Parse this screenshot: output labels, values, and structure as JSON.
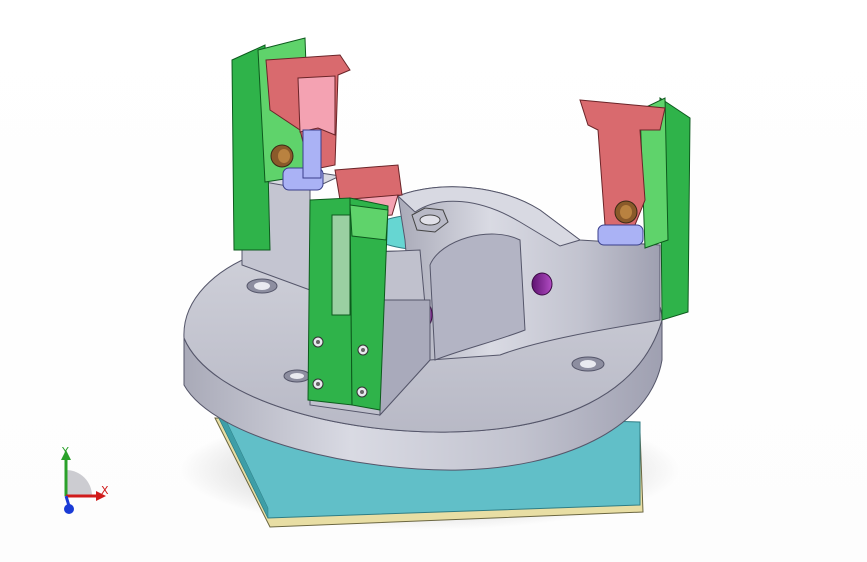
{
  "viewport": {
    "background": "#ffffff"
  },
  "colors": {
    "base_plate": "#61bfc8",
    "base_plate_shadow": "#3e9ea7",
    "shim": "#e8dea4",
    "fixture_body": "#c6c7d2",
    "fixture_body_shade": "#9c9db0",
    "clamp_green": "#2fb34a",
    "clamp_green_light": "#5fd36b",
    "clamp_red": "#d96a6e",
    "clamp_pink": "#f4a2b2",
    "bushing_blue": "#aab2f5",
    "bolt_purple": "#8a2b9a",
    "axis_x": "#d01b1b",
    "axis_y": "#2aa12a",
    "axis_z": "#1a3bd6"
  },
  "triad": {
    "x_label": "X",
    "y_label": "Y"
  }
}
